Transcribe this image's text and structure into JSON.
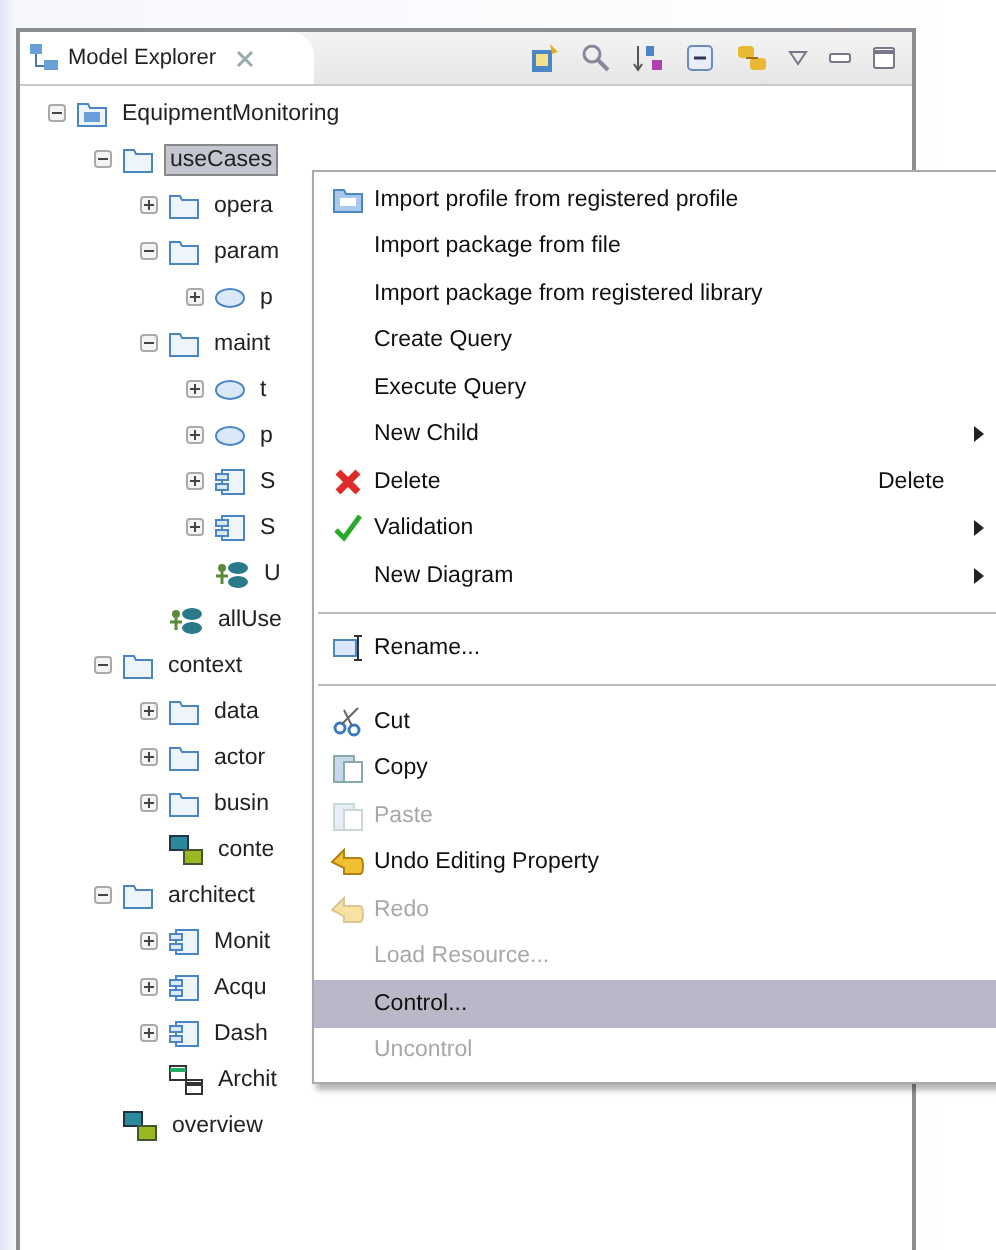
{
  "view": {
    "title": "Model Explorer"
  },
  "tree": [
    {
      "label": "EquipmentMonitoring",
      "kind": "model",
      "expanded": true,
      "selected": false,
      "children": [
        {
          "label": "useCases",
          "kind": "folder",
          "expanded": true,
          "selected": true,
          "children": [
            {
              "label": "opera",
              "kind": "folder",
              "expanded": false,
              "selected": false
            },
            {
              "label": "param",
              "kind": "folder",
              "expanded": true,
              "selected": false,
              "children": [
                {
                  "label": "p",
                  "kind": "usecase",
                  "expanded": false,
                  "selected": false
                }
              ]
            },
            {
              "label": "maint",
              "kind": "folder",
              "expanded": true,
              "selected": false,
              "children": [
                {
                  "label": "t",
                  "kind": "usecase",
                  "expanded": false,
                  "selected": false
                },
                {
                  "label": "p",
                  "kind": "usecase",
                  "expanded": false,
                  "selected": false
                },
                {
                  "label": "S",
                  "kind": "component",
                  "expanded": false,
                  "selected": false
                },
                {
                  "label": "S",
                  "kind": "component",
                  "expanded": false,
                  "selected": false
                },
                {
                  "label": "U",
                  "kind": "usecase-diagram",
                  "selected": false
                }
              ]
            },
            {
              "label": "allUse",
              "kind": "usecase-diagram",
              "selected": false
            }
          ]
        },
        {
          "label": "context",
          "kind": "folder",
          "expanded": true,
          "selected": false,
          "children": [
            {
              "label": "data",
              "kind": "folder",
              "expanded": false,
              "selected": false
            },
            {
              "label": "actor",
              "kind": "folder",
              "expanded": false,
              "selected": false
            },
            {
              "label": "busin",
              "kind": "folder",
              "expanded": false,
              "selected": false
            },
            {
              "label": "conte",
              "kind": "composite-diagram",
              "selected": false
            }
          ]
        },
        {
          "label": "architect",
          "kind": "folder",
          "expanded": true,
          "selected": false,
          "children": [
            {
              "label": "Monit",
              "kind": "component",
              "expanded": false,
              "selected": false
            },
            {
              "label": "Acqu",
              "kind": "component",
              "expanded": false,
              "selected": false
            },
            {
              "label": "Dash",
              "kind": "component",
              "expanded": false,
              "selected": false
            },
            {
              "label": "Archit",
              "kind": "class-diagram",
              "selected": false
            }
          ]
        },
        {
          "label": "overview",
          "kind": "composite-diagram",
          "selected": false
        }
      ]
    }
  ],
  "context_menu": {
    "groups": [
      [
        {
          "label": "Import profile from registered profile",
          "kind": "package",
          "disabled": false,
          "selected": false
        },
        {
          "label": "Import package from file",
          "kind": "plain",
          "disabled": false,
          "selected": false
        },
        {
          "label": "Import package from registered library",
          "kind": "plain",
          "disabled": false,
          "selected": false
        },
        {
          "label": "Create Query",
          "kind": "plain",
          "disabled": false,
          "selected": false
        },
        {
          "label": "Execute Query",
          "kind": "plain",
          "disabled": false,
          "selected": false
        },
        {
          "label": "New Child",
          "kind": "plain",
          "disabled": false,
          "selected": false,
          "submenu": true
        },
        {
          "label": "Delete",
          "kind": "delete",
          "shortcut": "Delete",
          "disabled": false,
          "selected": false
        },
        {
          "label": "Validation",
          "kind": "check",
          "disabled": false,
          "selected": false,
          "submenu": true
        },
        {
          "label": "New Diagram",
          "kind": "plain",
          "disabled": false,
          "selected": false,
          "submenu": true
        }
      ],
      [
        {
          "label": "Rename...",
          "kind": "rename",
          "disabled": false,
          "selected": false
        }
      ],
      [
        {
          "label": "Cut",
          "kind": "cut",
          "disabled": false,
          "selected": false
        },
        {
          "label": "Copy",
          "kind": "copy",
          "disabled": false,
          "selected": false
        },
        {
          "label": "Paste",
          "kind": "paste",
          "disabled": true,
          "selected": false
        },
        {
          "label": "Undo Editing Property",
          "kind": "undo",
          "disabled": false,
          "selected": false
        },
        {
          "label": "Redo",
          "kind": "redo",
          "disabled": true,
          "selected": false
        },
        {
          "label": "Load Resource...",
          "kind": "plain",
          "disabled": true,
          "selected": false
        },
        {
          "label": "Control...",
          "kind": "plain",
          "disabled": false,
          "selected": true
        },
        {
          "label": "Uncontrol",
          "kind": "plain",
          "disabled": true,
          "selected": false
        }
      ]
    ]
  }
}
